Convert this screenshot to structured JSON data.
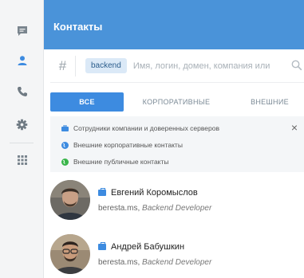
{
  "header": {
    "title": "Контакты"
  },
  "search": {
    "hash_symbol": "#",
    "chip": "backend",
    "placeholder": "Имя, логин, домен, компания или"
  },
  "tabs": [
    {
      "label": "ВСЕ",
      "active": true
    },
    {
      "label": "КОРПОРАТИВНЫЕ",
      "active": false
    },
    {
      "label": "ВНЕШНИЕ",
      "active": false
    }
  ],
  "info": {
    "close": "×",
    "items": [
      {
        "text": "Сотрудники компании и доверенных серверов",
        "icon": "briefcase-icon",
        "color": "#3d8be0"
      },
      {
        "text": "Внешние корпоративные контакты",
        "icon": "globe-icon",
        "color": "#3d8be0"
      },
      {
        "text": "Внешние публичные контакты",
        "icon": "globe-icon",
        "color": "#39b54a"
      }
    ]
  },
  "contacts": [
    {
      "name": "Евгений Коромыслов",
      "domain": "beresta.ms,",
      "role": "Backend Developer"
    },
    {
      "name": "Андрей Бабушкин",
      "domain": "beresta.ms,",
      "role": "Backend Developer"
    }
  ],
  "sidebar": {
    "items": [
      {
        "icon": "chat-icon"
      },
      {
        "icon": "contacts-icon",
        "active": true
      },
      {
        "icon": "phone-icon"
      },
      {
        "icon": "gear-icon"
      },
      {
        "icon": "apps-grid-icon"
      }
    ]
  },
  "colors": {
    "accent": "#4a93d9",
    "active_tab": "#3d8be0",
    "public_green": "#39b54a"
  }
}
